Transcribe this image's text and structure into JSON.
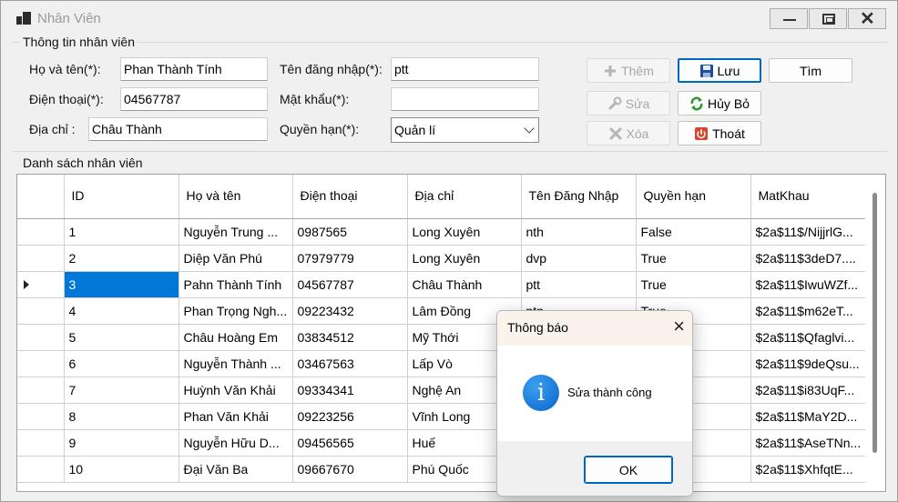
{
  "window": {
    "title": "Nhân Viên",
    "controls": {
      "minimize": "minimize-icon",
      "maximize": "maximize-icon",
      "close": "✕"
    }
  },
  "info_group": {
    "title": "Thông tin nhân viên",
    "fullname_label": "Họ và tên(*):",
    "fullname_value": "Phan Thành Tính",
    "phone_label": "Điện thoại(*):",
    "phone_value": "04567787",
    "address_label": "Địa chỉ :",
    "address_value": "Châu Thành",
    "username_label": "Tên đăng nhập(*):",
    "username_value": "ptt",
    "password_label": "Mật khẩu(*):",
    "password_value": "",
    "role_label": "Quyền hạn(*):",
    "role_value": "Quản lí"
  },
  "buttons": {
    "add": "Thêm",
    "save": "Lưu",
    "find": "Tìm",
    "edit": "Sửa",
    "cancel": "Hủy Bỏ",
    "delete": "Xóa",
    "exit": "Thoát"
  },
  "list_group": {
    "title": "Danh sách nhân viên",
    "columns": [
      "ID",
      "Họ và tên",
      "Điện thoại",
      "Địa chỉ",
      "Tên Đăng Nhập",
      "Quyền hạn",
      "MatKhau"
    ],
    "rows": [
      [
        "1",
        "Nguyễn Trung ...",
        "0987565",
        "Long Xuyên",
        "nth",
        "False",
        "$2a$11$/NijjrlG..."
      ],
      [
        "2",
        "Diệp Văn Phú",
        "07979779",
        "Long Xuyên",
        "dvp",
        "True",
        "$2a$11$3deD7...."
      ],
      [
        "3",
        "Pahn Thành Tính",
        "04567787",
        "Châu Thành",
        "ptt",
        "True",
        "$2a$11$IwuWZf..."
      ],
      [
        "4",
        "Phan Trọng Ngh...",
        "09223432",
        "Lâm Đồng",
        "ptn",
        "True",
        "$2a$11$m62eT..."
      ],
      [
        "5",
        "Châu Hoàng Em",
        "03834512",
        "Mỹ Thới",
        "",
        "",
        "$2a$11$Qfaglvi..."
      ],
      [
        "6",
        "Nguyễn Thành ...",
        "03467563",
        "Lấp Vò",
        "",
        "",
        "$2a$11$9deQsu..."
      ],
      [
        "7",
        "Huỳnh Văn Khải",
        "09334341",
        "Nghệ An",
        "",
        "",
        "$2a$11$i83UqF..."
      ],
      [
        "8",
        "Phan Văn Khải",
        "09223256",
        "Vĩnh Long",
        "",
        "",
        "$2a$11$MaY2D..."
      ],
      [
        "9",
        "Nguyễn Hữu D...",
        "09456565",
        "Huế",
        "",
        "",
        "$2a$11$AseTNn..."
      ],
      [
        "10",
        "Đại Văn Ba",
        "09667670",
        "Phú Quốc",
        "",
        "",
        "$2a$11$XhfqtE..."
      ]
    ],
    "selected_row": 2
  },
  "dialog": {
    "title": "Thông báo",
    "message": "Sửa thành công",
    "ok": "OK",
    "icon": "info-icon"
  },
  "colors": {
    "selection": "#0078d7",
    "focus": "#0067c0",
    "dialog_header": "#faf3ec"
  }
}
